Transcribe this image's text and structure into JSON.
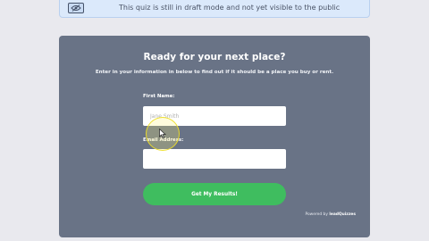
{
  "banner": {
    "icon": "eye-off-icon",
    "text": "This quiz is still in draft mode and not yet visible to the public"
  },
  "quiz": {
    "title": "Ready for your next place?",
    "subtitle": "Enter in your information in below to find out if it should be a place you buy or rent.",
    "first_name": {
      "label": "First Name:",
      "placeholder": "Jane Smith"
    },
    "email": {
      "label": "Email Address:",
      "value": ""
    },
    "submit_label": "Get My Results!",
    "powered_by_prefix": "Powered by",
    "powered_by_brand": "leadQuizzes"
  },
  "colors": {
    "card_bg": "#697386",
    "banner_bg": "#dbe9fb",
    "button": "#3fbd5f",
    "cursor_highlight": "#eede28"
  }
}
